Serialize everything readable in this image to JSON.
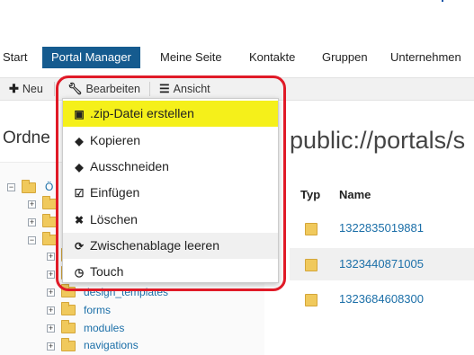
{
  "nav": {
    "items": [
      "Start",
      "Portal Manager",
      "Meine Seite",
      "Kontakte",
      "Gruppen",
      "Unternehmen"
    ],
    "active_index": 1
  },
  "toolbar": {
    "new_label": "Neu",
    "edit_label": "Bearbeiten",
    "view_label": "Ansicht"
  },
  "headings": {
    "folder": "Ordne",
    "path": "public://portals/s"
  },
  "tree": {
    "root_label": "Ö",
    "items": [
      "design_templates",
      "forms",
      "modules",
      "navigations"
    ]
  },
  "table": {
    "col_type": "Typ",
    "col_name": "Name",
    "rows": [
      "1322835019881",
      "1323440871005",
      "1323684608300"
    ]
  },
  "menu": {
    "items": [
      {
        "label": ".zip-Datei erstellen",
        "icon": "archive-icon"
      },
      {
        "label": "Kopieren",
        "icon": "tag-icon"
      },
      {
        "label": "Ausschneiden",
        "icon": "tag-icon"
      },
      {
        "label": "Einfügen",
        "icon": "check-square-icon"
      },
      {
        "label": "Löschen",
        "icon": "x-icon"
      },
      {
        "label": "Zwischenablage leeren",
        "icon": "refresh-icon"
      },
      {
        "label": "Touch",
        "icon": "clock-icon"
      }
    ],
    "highlight_index": 0,
    "hover_index": 5
  },
  "colors": {
    "nav_active": "#155b8f",
    "link": "#1b6fa8",
    "highlight": "#f5f01a",
    "annotation": "#e01a27"
  }
}
